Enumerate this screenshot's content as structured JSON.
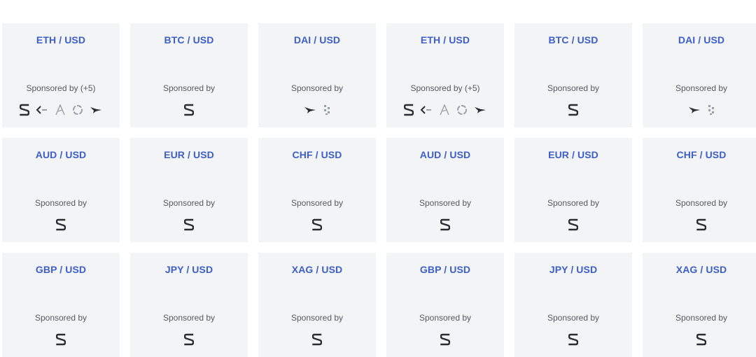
{
  "feeds": [
    {
      "pair": "ETH / USD",
      "sponsored_label": "Sponsored by (+5)",
      "sponsor_icons": [
        "s-logo-icon",
        "arrows-logo-icon",
        "a-logo-icon",
        "ring-logo-icon",
        "bird-logo-icon"
      ]
    },
    {
      "pair": "BTC / USD",
      "sponsored_label": "Sponsored by",
      "sponsor_icons": [
        "s-logo-icon"
      ]
    },
    {
      "pair": "DAI / USD",
      "sponsored_label": "Sponsored by",
      "sponsor_icons": [
        "bird-logo-icon",
        "checker-logo-icon"
      ]
    },
    {
      "pair": "ETH / USD",
      "sponsored_label": "Sponsored by (+5)",
      "sponsor_icons": [
        "s-logo-icon",
        "arrows-logo-icon",
        "a-logo-icon",
        "ring-logo-icon",
        "bird-logo-icon"
      ]
    },
    {
      "pair": "BTC / USD",
      "sponsored_label": "Sponsored by",
      "sponsor_icons": [
        "s-logo-icon"
      ]
    },
    {
      "pair": "DAI / USD",
      "sponsored_label": "Sponsored by",
      "sponsor_icons": [
        "bird-logo-icon",
        "checker-logo-icon"
      ]
    },
    {
      "pair": "AUD / USD",
      "sponsored_label": "Sponsored by",
      "sponsor_icons": [
        "s-logo-icon"
      ]
    },
    {
      "pair": "EUR / USD",
      "sponsored_label": "Sponsored by",
      "sponsor_icons": [
        "s-logo-icon"
      ]
    },
    {
      "pair": "CHF / USD",
      "sponsored_label": "Sponsored by",
      "sponsor_icons": [
        "s-logo-icon"
      ]
    },
    {
      "pair": "AUD / USD",
      "sponsored_label": "Sponsored by",
      "sponsor_icons": [
        "s-logo-icon"
      ]
    },
    {
      "pair": "EUR / USD",
      "sponsored_label": "Sponsored by",
      "sponsor_icons": [
        "s-logo-icon"
      ]
    },
    {
      "pair": "CHF / USD",
      "sponsored_label": "Sponsored by",
      "sponsor_icons": [
        "s-logo-icon"
      ]
    },
    {
      "pair": "GBP / USD",
      "sponsored_label": "Sponsored by",
      "sponsor_icons": [
        "s-logo-icon"
      ]
    },
    {
      "pair": "JPY / USD",
      "sponsored_label": "Sponsored by",
      "sponsor_icons": [
        "s-logo-icon"
      ]
    },
    {
      "pair": "XAG / USD",
      "sponsored_label": "Sponsored by",
      "sponsor_icons": [
        "s-logo-icon"
      ]
    },
    {
      "pair": "GBP / USD",
      "sponsored_label": "Sponsored by",
      "sponsor_icons": [
        "s-logo-icon"
      ]
    },
    {
      "pair": "JPY / USD",
      "sponsored_label": "Sponsored by",
      "sponsor_icons": [
        "s-logo-icon"
      ]
    },
    {
      "pair": "XAG / USD",
      "sponsored_label": "Sponsored by",
      "sponsor_icons": [
        "s-logo-icon"
      ]
    }
  ],
  "colors": {
    "card_bg": "#f3f4f6",
    "pair_text": "#3d5ec9",
    "sponsored_text": "#555a62",
    "logo_dark": "#2b2d33",
    "logo_light": "#9aa0a8"
  }
}
